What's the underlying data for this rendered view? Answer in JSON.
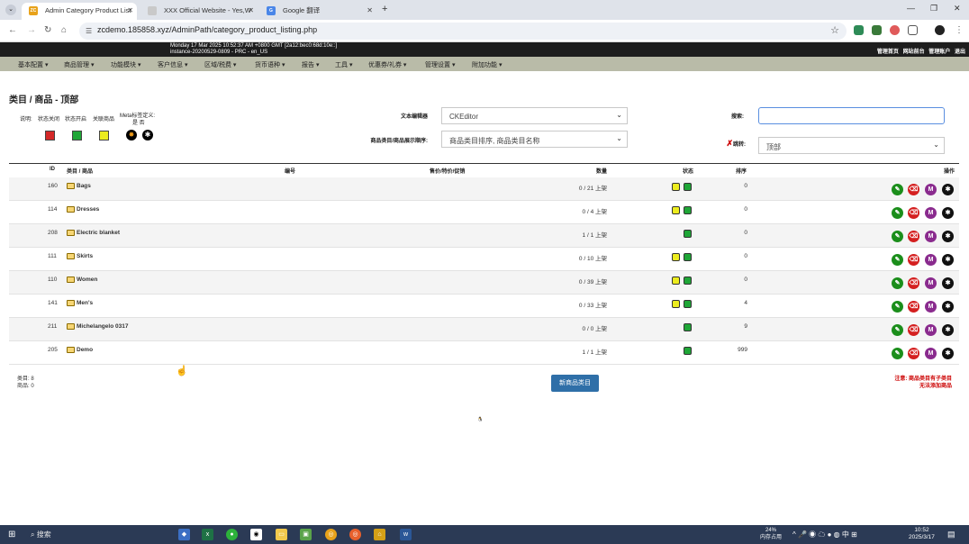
{
  "browser": {
    "tabs": [
      {
        "title": "Admin Category Product List",
        "favicon": "ZC",
        "active": true
      },
      {
        "title": "XXX Official Website - Yes,W",
        "active": false
      },
      {
        "title": "Google 翻译",
        "active": false
      }
    ],
    "url": "zcdemo.185858.xyz/AdminPath/category_product_listing.php"
  },
  "admin_header": {
    "info_line1": "Monday 17 Mar 2025 10:52:37 AM +0800 GMT [2a12:bec0:68d:10e::]",
    "info_line2": "instance-20200529-0809 - PRC - en_US",
    "links": [
      "管理首页",
      "网站前台",
      "管理账户",
      "退出"
    ]
  },
  "menu": [
    "基本配置 ▾",
    "商品管理 ▾",
    "功能模块 ▾",
    "客户信息 ▾",
    "区域/税费 ▾",
    "货币语种 ▾",
    "报告 ▾",
    "工具 ▾",
    "优惠券/礼券 ▾",
    "管理设置 ▾",
    "附加功能 ▾"
  ],
  "page": {
    "title": "类目 / 商品 - 顶部",
    "legend": {
      "label": "说明:",
      "status_off": "状态关闭",
      "status_on": "状态开启",
      "linked": "关联商品",
      "meta_label": "Meta标签定义:",
      "meta_yes_no": "是 否"
    },
    "editor_label": "文本编辑器",
    "editor_value": "CKEditor",
    "sort_label": "商品类目/商品展示顺序:",
    "sort_value": "商品类目排序, 商品类目名称",
    "search_label": "搜索:",
    "goto_label": "跳转:",
    "goto_value": "顶部"
  },
  "table": {
    "headers": {
      "id": "ID",
      "name": "类目 / 商品",
      "code": "编号",
      "price": "售价/特价/促销",
      "qty": "数量",
      "status": "状态",
      "sort": "排序",
      "action": "操作"
    },
    "rows": [
      {
        "id": "160",
        "name": "Bags",
        "qty": "0 / 21 上架",
        "sort": "0"
      },
      {
        "id": "114",
        "name": "Dresses",
        "qty": "0 / 4 上架",
        "sort": "0"
      },
      {
        "id": "208",
        "name": "Electric blanket",
        "qty": "1 / 1 上架",
        "sort": "0"
      },
      {
        "id": "111",
        "name": "Skirts",
        "qty": "0 / 10 上架",
        "sort": "0"
      },
      {
        "id": "110",
        "name": "Women",
        "qty": "0 / 39 上架",
        "sort": "0"
      },
      {
        "id": "141",
        "name": "Men's",
        "qty": "0 / 33 上架",
        "sort": "4"
      },
      {
        "id": "211",
        "name": "Michelangelo 0317",
        "qty": "0 / 0 上架",
        "sort": "9"
      },
      {
        "id": "205",
        "name": "Demo",
        "qty": "1 / 1 上架",
        "sort": "999"
      }
    ]
  },
  "footer": {
    "categories_count": "类目: 8",
    "products_count": "商品: 0",
    "new_category_button": "新商品类目",
    "note_line1": "注意: 商品类目有子类目",
    "note_line2": "无法添加商品"
  },
  "taskbar": {
    "search": "搜索",
    "mem_percent": "24%",
    "mem_label": "内存占用",
    "ime": "中",
    "time": "10:52",
    "date": "2025/3/17"
  }
}
